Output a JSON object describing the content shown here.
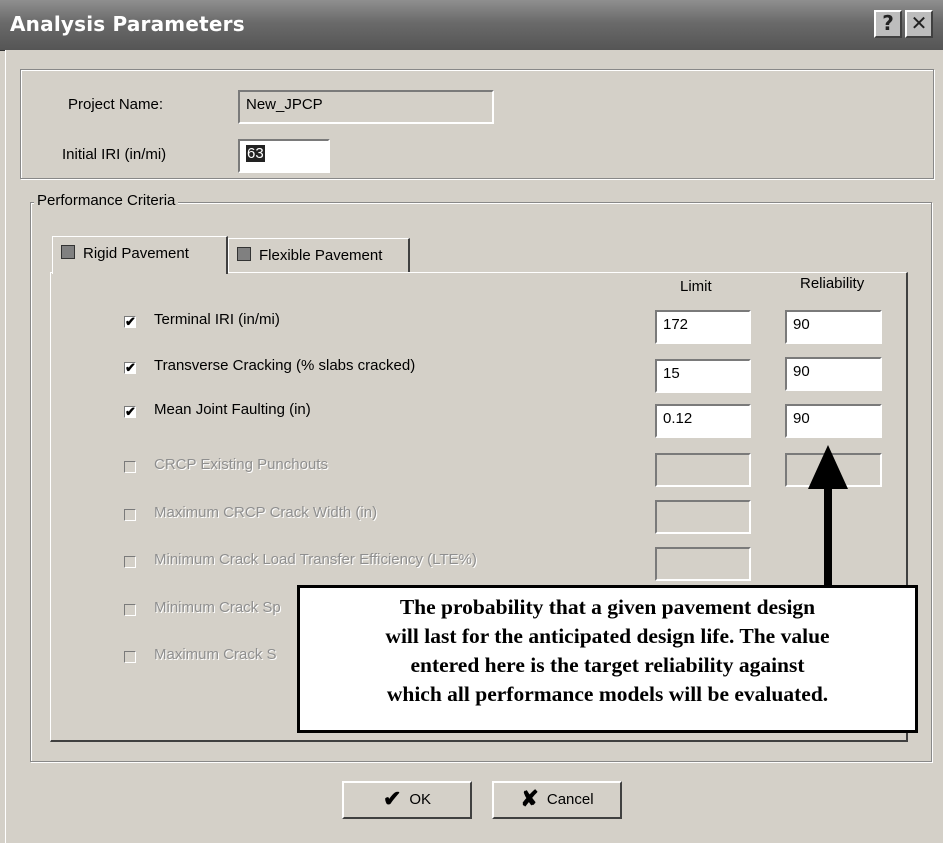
{
  "window": {
    "title": "Analysis Parameters",
    "help_glyph": "?",
    "close_glyph": "✕"
  },
  "project": {
    "name_label": "Project Name:",
    "name_value": "New_JPCP",
    "iri_label": "Initial IRI (in/mi)",
    "iri_value": "63"
  },
  "performance": {
    "group_label": "Performance Criteria",
    "tabs": [
      {
        "label": "Rigid Pavement",
        "active": true
      },
      {
        "label": "Flexible Pavement",
        "active": false
      }
    ],
    "columns": {
      "limit": "Limit",
      "reliability": "Reliability"
    },
    "criteria": [
      {
        "label": "Terminal IRI (in/mi)",
        "checked": true,
        "enabled": true,
        "limit": "172",
        "reliability": "90"
      },
      {
        "label": "Transverse Cracking (% slabs cracked)",
        "checked": true,
        "enabled": true,
        "limit": "15",
        "reliability": "90"
      },
      {
        "label": "Mean Joint Faulting (in)",
        "checked": true,
        "enabled": true,
        "limit": "0.12",
        "reliability": "90"
      },
      {
        "label": "CRCP Existing Punchouts",
        "checked": false,
        "enabled": false,
        "limit": "",
        "reliability": ""
      },
      {
        "label": "Maximum CRCP Crack Width (in)",
        "checked": false,
        "enabled": false,
        "limit": ""
      },
      {
        "label": "Minimum Crack Load Transfer Efficiency (LTE%)",
        "checked": false,
        "enabled": false,
        "limit": ""
      },
      {
        "label": "Minimum Crack Sp",
        "checked": false,
        "enabled": false
      },
      {
        "label": "Maximum Crack S",
        "checked": false,
        "enabled": false
      }
    ]
  },
  "callout": {
    "lines": [
      "The probability that a given pavement design",
      "will last for the anticipated design life.  The value",
      "entered here is the target reliability against",
      "which all performance models will be evaluated."
    ]
  },
  "buttons": {
    "ok_label": "OK",
    "ok_glyph": "✔",
    "cancel_label": "Cancel",
    "cancel_glyph": "✘"
  }
}
